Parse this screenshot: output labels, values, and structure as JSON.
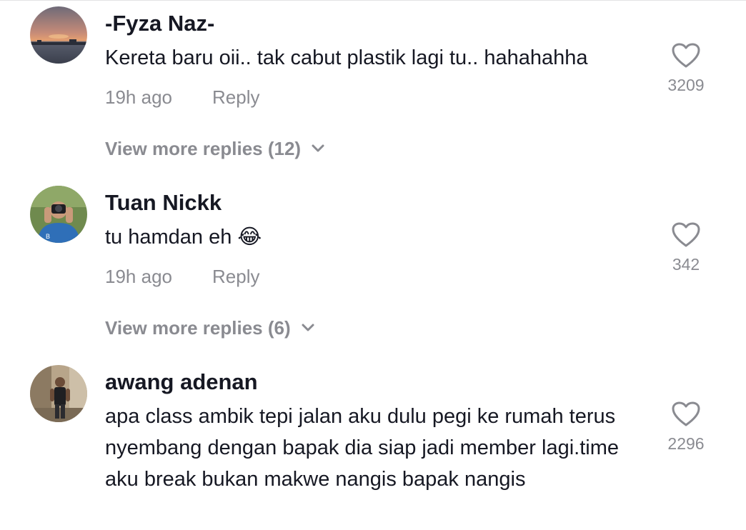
{
  "comments": [
    {
      "username": "-Fyza Naz-",
      "text": "Kereta baru oii.. tak cabut plastik lagi tu.. hahahahha",
      "time": "19h ago",
      "reply_label": "Reply",
      "likes": "3209",
      "more_replies": "View more replies (12)",
      "avatar_icon": "sunset-photo-avatar"
    },
    {
      "username": "Tuan Nickk",
      "text": "tu hamdan eh 😂",
      "time": "19h ago",
      "reply_label": "Reply",
      "likes": "342",
      "more_replies": "View more replies (6)",
      "avatar_icon": "photographer-avatar"
    },
    {
      "username": "awang adenan",
      "text": "apa class ambik tepi jalan aku dulu pegi ke rumah terus nyembang dengan bapak dia siap jadi member lagi.time aku break bukan makwe nangis bapak nangis",
      "time": "",
      "reply_label": "",
      "likes": "2296",
      "more_replies": "",
      "avatar_icon": "man-standing-avatar"
    }
  ],
  "colors": {
    "primary_text": "#161823",
    "secondary_text": "#8a8b91",
    "icon": "#8a8b91"
  }
}
